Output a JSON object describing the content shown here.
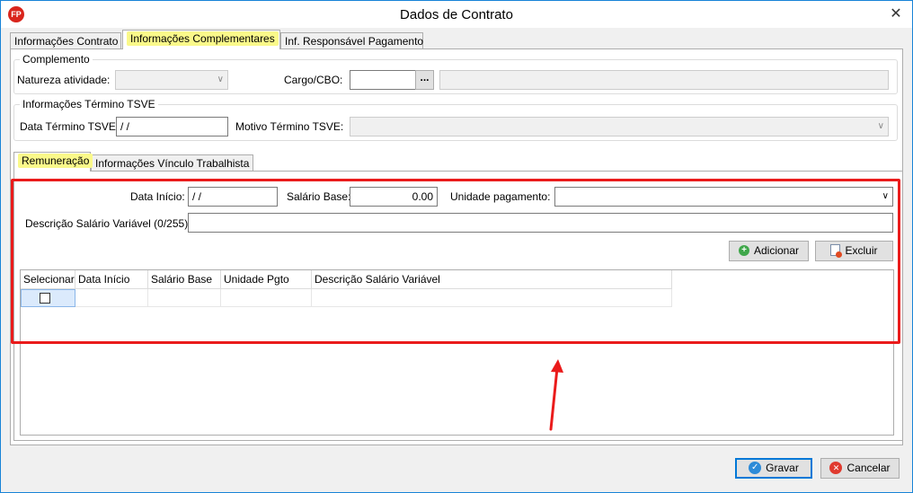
{
  "window": {
    "title": "Dados de Contrato",
    "close_glyph": "✕",
    "app_icon_text": "FP"
  },
  "tabs": [
    "Informações Contrato",
    "Informações Complementares",
    "Inf. Responsável Pagamento"
  ],
  "complemento": {
    "legend": "Complemento",
    "natureza_label": "Natureza atividade:",
    "natureza_value": "",
    "cargo_label": "Cargo/CBO:",
    "cargo_value": "",
    "cargo_button": "...",
    "cargo_desc": ""
  },
  "termino": {
    "legend": "Informações Término TSVE",
    "data_label": "Data Término TSVE:",
    "data_value": " / /",
    "motivo_label": "Motivo Término TSVE:",
    "motivo_value": ""
  },
  "subtabs": [
    "Remuneração",
    "Informações Vínculo Trabalhista"
  ],
  "remuneracao": {
    "data_inicio_label": "Data Início:",
    "data_inicio_value": " / /",
    "salario_label": "Salário Base:",
    "salario_value": "0.00",
    "unidade_label": "Unidade pagamento:",
    "unidade_value": "",
    "descricao_label": "Descrição Salário Variável (0/255):",
    "descricao_value": "",
    "adicionar_label": "Adicionar",
    "excluir_label": "Excluir"
  },
  "grid": {
    "columns": [
      "Selecionar",
      "Data Início",
      "Salário Base",
      "Unidade Pgto",
      "Descrição Salário Variável"
    ],
    "rows": [
      {
        "selecionar": false,
        "data_inicio": "",
        "salario_base": "",
        "unidade_pgto": "",
        "descricao": ""
      }
    ]
  },
  "footer": {
    "gravar_label": "Gravar",
    "cancelar_label": "Cancelar"
  },
  "icons": {
    "combo": "chevron-down-icon",
    "add": "add-icon",
    "delete": "delete-icon",
    "ok": "ok-icon",
    "cancel": "cancel-icon",
    "close": "close-icon"
  },
  "colors": {
    "highlight": "#faf98a",
    "annotation_red": "#ea1b1b",
    "accent": "#0078d7"
  }
}
